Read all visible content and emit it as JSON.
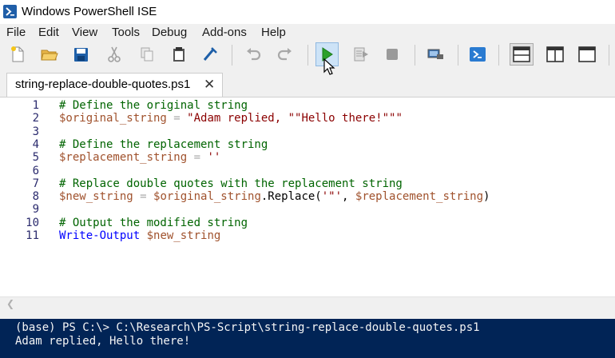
{
  "window": {
    "title": "Windows PowerShell ISE"
  },
  "menu": {
    "items": [
      "File",
      "Edit",
      "View",
      "Tools",
      "Debug",
      "Add-ons",
      "Help"
    ]
  },
  "toolbar": {
    "buttons": [
      "new-file-icon",
      "open-folder-icon",
      "save-icon",
      "cut-icon",
      "copy-icon",
      "paste-icon",
      "clear-console-icon",
      "undo-icon",
      "redo-icon",
      "run-script-icon",
      "run-selection-icon",
      "stop-icon",
      "remote-powershell-icon",
      "powershell-console-icon",
      "layout-top-icon",
      "layout-right-icon",
      "layout-max-icon"
    ]
  },
  "tab": {
    "label": "string-replace-double-quotes.ps1",
    "close": "✕"
  },
  "editor": {
    "lines": [
      {
        "num": "1",
        "parts": [
          {
            "t": "# Define the original string",
            "c": "comment"
          }
        ]
      },
      {
        "num": "2",
        "parts": [
          {
            "t": "$original_string",
            "c": "var"
          },
          {
            "t": " = ",
            "c": "op"
          },
          {
            "t": "\"Adam replied, \"\"Hello there!\"\"\"",
            "c": "str"
          }
        ]
      },
      {
        "num": "3",
        "parts": []
      },
      {
        "num": "4",
        "parts": [
          {
            "t": "# Define the replacement string",
            "c": "comment"
          }
        ]
      },
      {
        "num": "5",
        "parts": [
          {
            "t": "$replacement_string",
            "c": "var"
          },
          {
            "t": " = ",
            "c": "op"
          },
          {
            "t": "''",
            "c": "str"
          }
        ]
      },
      {
        "num": "6",
        "parts": []
      },
      {
        "num": "7",
        "parts": [
          {
            "t": "# Replace double quotes with the replacement string",
            "c": "comment"
          }
        ]
      },
      {
        "num": "8",
        "parts": [
          {
            "t": "$new_string",
            "c": "var"
          },
          {
            "t": " = ",
            "c": "op"
          },
          {
            "t": "$original_string",
            "c": "var"
          },
          {
            "t": ".Replace(",
            "c": "plain"
          },
          {
            "t": "'\"'",
            "c": "str"
          },
          {
            "t": ", ",
            "c": "plain"
          },
          {
            "t": "$replacement_string",
            "c": "var"
          },
          {
            "t": ")",
            "c": "plain"
          }
        ]
      },
      {
        "num": "9",
        "parts": []
      },
      {
        "num": "10",
        "parts": [
          {
            "t": "# Output the modified string",
            "c": "comment"
          }
        ]
      },
      {
        "num": "11",
        "parts": [
          {
            "t": "Write-Output",
            "c": "cmd"
          },
          {
            "t": " ",
            "c": "plain"
          },
          {
            "t": "$new_string",
            "c": "var"
          }
        ]
      }
    ]
  },
  "console": {
    "lines": [
      "(base) PS C:\\> C:\\Research\\PS-Script\\string-replace-double-quotes.ps1",
      "Adam replied, Hello there!"
    ]
  }
}
